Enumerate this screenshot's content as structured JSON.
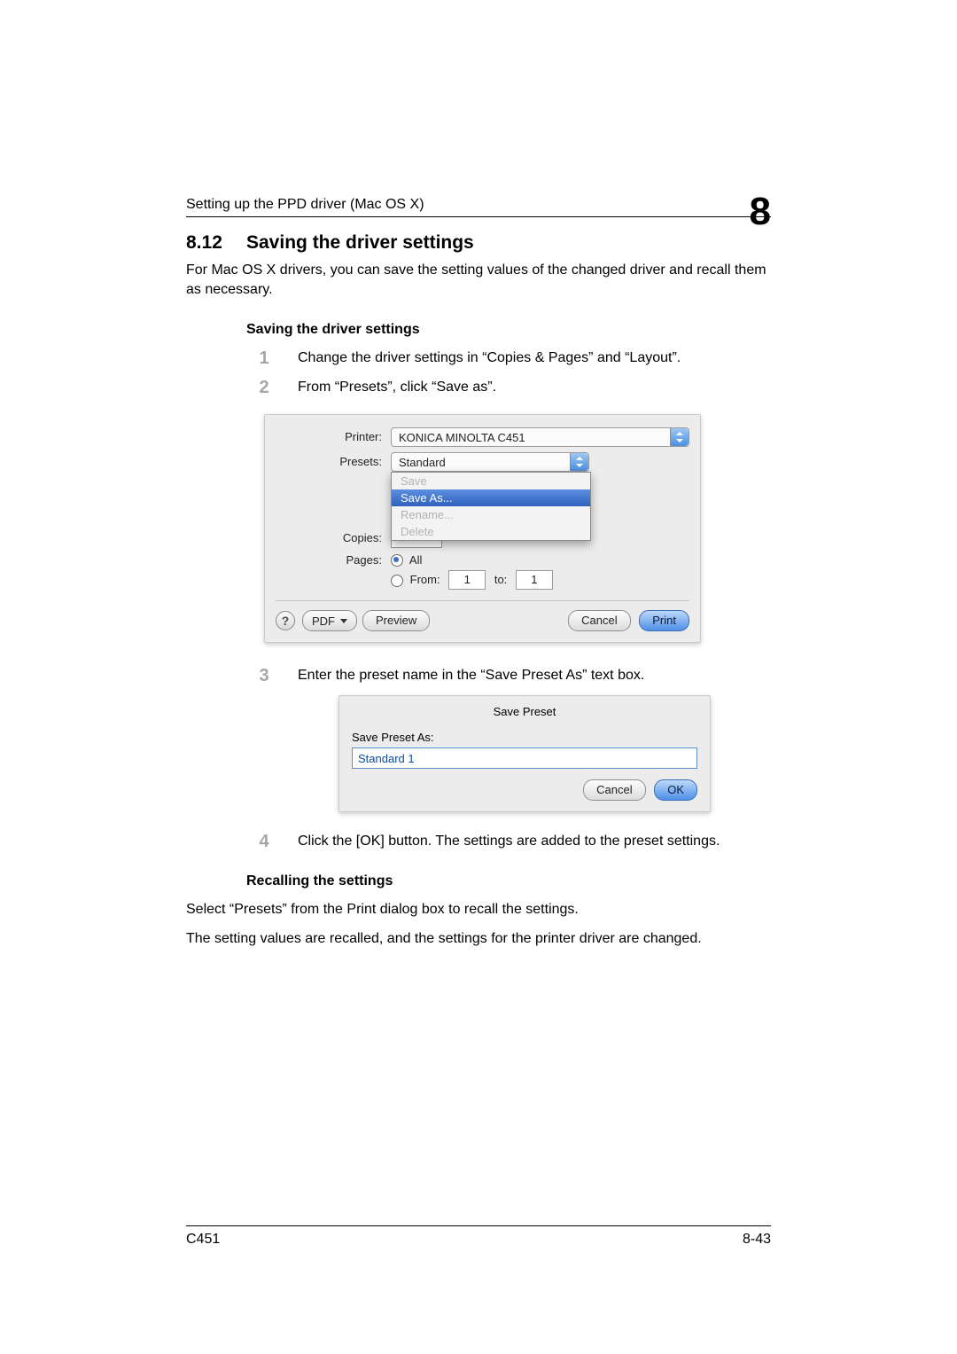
{
  "header": {
    "running_title": "Setting up the PPD driver (Mac OS X)",
    "chapter_number": "8"
  },
  "section": {
    "number": "8.12",
    "title": "Saving the driver settings",
    "intro": "For Mac OS X drivers, you can save the setting values of the changed driver and recall them as necessary."
  },
  "sub_heading_a": "Saving the driver settings",
  "steps": {
    "s1": {
      "num": "1",
      "text": "Change the driver settings in “Copies & Pages” and “Layout”."
    },
    "s2": {
      "num": "2",
      "text": "From “Presets”, click “Save as”."
    },
    "s3": {
      "num": "3",
      "text": "Enter the preset name in the “Save Preset As” text box."
    },
    "s4": {
      "num": "4",
      "text": "Click the [OK] button. The settings are added to the preset settings."
    }
  },
  "dialog1": {
    "printer_label": "Printer:",
    "printer_value": "KONICA MINOLTA C451",
    "presets_label": "Presets:",
    "presets_value": "Standard",
    "menu": {
      "save": "Save",
      "save_as": "Save As...",
      "rename": "Rename...",
      "delete": "Delete"
    },
    "copies_label": "Copies:",
    "pages_label": "Pages:",
    "pages_all": "All",
    "pages_from_label": "From:",
    "pages_from_value": "1",
    "pages_to_label": "to:",
    "pages_to_value": "1",
    "help_icon": "?",
    "pdf_label": "PDF",
    "preview_label": "Preview",
    "cancel_label": "Cancel",
    "print_label": "Print"
  },
  "dialog2": {
    "title": "Save Preset",
    "field_label": "Save Preset As:",
    "field_value": "Standard 1",
    "cancel_label": "Cancel",
    "ok_label": "OK"
  },
  "sub_heading_b": "Recalling the settings",
  "recall_p1": "Select “Presets” from the Print dialog box to recall the settings.",
  "recall_p2": "The setting values are recalled, and the settings for the printer driver are changed.",
  "footer": {
    "left": "C451",
    "right": "8-43"
  }
}
